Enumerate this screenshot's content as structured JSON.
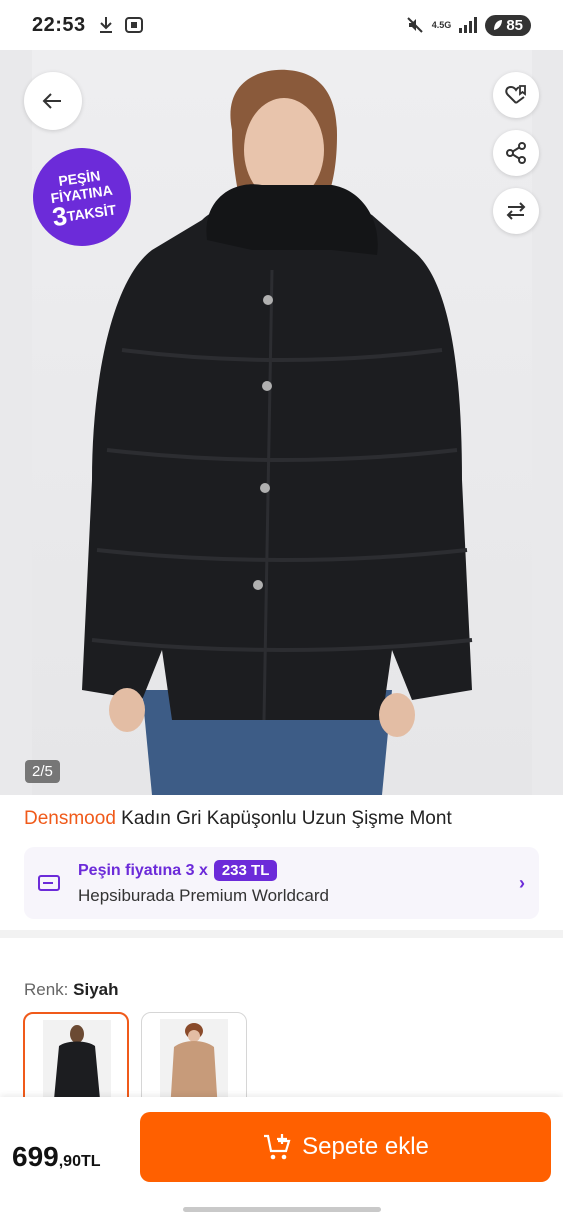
{
  "status_bar": {
    "time": "22:53",
    "network": "4.5G",
    "battery": "85"
  },
  "gallery": {
    "badge": {
      "line1": "PEŞİN",
      "line2": "FİYATINA",
      "number": "3",
      "word": "TAKSİT"
    },
    "counter": "2/5"
  },
  "product": {
    "brand": "Densmood",
    "name": "Kadın Gri Kapüşonlu Uzun Şişme Mont"
  },
  "installment": {
    "label": "Peşin fiyatına 3 x",
    "amount": "233 TL",
    "card_name": "Hepsiburada Premium Worldcard"
  },
  "color": {
    "label": "Renk:",
    "value": "Siyah",
    "options": [
      "black-coat",
      "camel-coat"
    ]
  },
  "bottom": {
    "price_main": "699",
    "price_decimal": ",90TL",
    "cart_label": "Sepete ekle"
  },
  "colors": {
    "brand_orange": "#ff6000",
    "brand_purple": "#6c2bd9"
  }
}
